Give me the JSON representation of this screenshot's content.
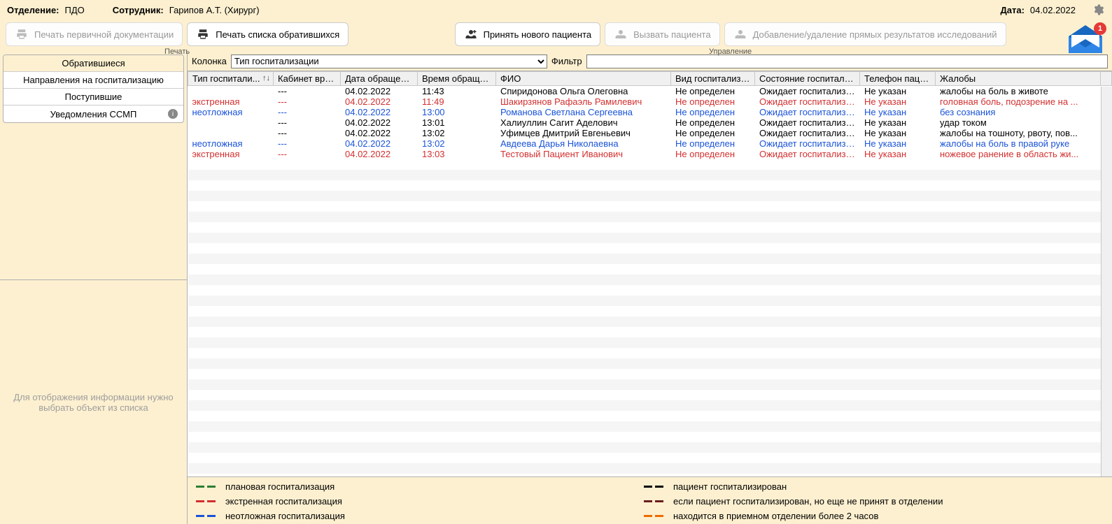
{
  "header": {
    "dept_label": "Отделение:",
    "dept_value": "ПДО",
    "employee_label": "Сотрудник:",
    "employee_value": "Гарипов А.Т. (Хирург)",
    "date_label": "Дата:",
    "date_value": "04.02.2022"
  },
  "toolbar": {
    "print_primary": "Печать первичной документации",
    "print_list": "Печать списка обратившихся",
    "group_print": "Печать",
    "accept_new": "Принять нового пациента",
    "call_patient": "Вызвать пациента",
    "add_remove_results": "Добавление/удаление прямых результатов исследований",
    "group_manage": "Управление",
    "mail_count": "1"
  },
  "nav": {
    "items": [
      {
        "label": "Обратившиеся",
        "active": true
      },
      {
        "label": "Направления на госпитализацию"
      },
      {
        "label": "Поступившие"
      },
      {
        "label": "Уведомления ССМП",
        "info": true
      }
    ]
  },
  "left_info": "Для отображения информации нужно выбрать объект из списка",
  "filter": {
    "column_label": "Колонка",
    "column_selected": "Тип госпитализации",
    "filter_label": "Фильтр",
    "filter_value": ""
  },
  "table": {
    "columns": [
      "Тип госпитали...",
      "Кабинет врача",
      "Дата обращения",
      "Время обращения",
      "ФИО",
      "Вид госпитализации",
      "Состояние госпитализации",
      "Телефон пациента",
      "Жалобы"
    ],
    "rows": [
      {
        "style": "black",
        "type": "",
        "cab": "---",
        "date": "04.02.2022",
        "time": "11:43",
        "fio": "Спиридонова Ольга Олеговна",
        "vid": "Не определен",
        "state": "Ожидает госпитализацию",
        "tel": "Не указан",
        "compl": "жалобы на боль в животе"
      },
      {
        "style": "red",
        "type": "экстренная",
        "cab": "---",
        "date": "04.02.2022",
        "time": "11:49",
        "fio": "Шакирзянов Рафаэль Рамилевич",
        "vid": "Не определен",
        "state": "Ожидает госпитализацию",
        "tel": "Не указан",
        "compl": "головная боль, подозрение на ..."
      },
      {
        "style": "blue",
        "type": "неотложная",
        "cab": "---",
        "date": "04.02.2022",
        "time": "13:00",
        "fio": "Романова Светлана Сергеевна",
        "vid": "Не определен",
        "state": "Ожидает госпитализацию",
        "tel": "Не указан",
        "compl": "без сознания"
      },
      {
        "style": "black",
        "type": "",
        "cab": "---",
        "date": "04.02.2022",
        "time": "13:01",
        "fio": "Халиуллин Сагит Аделович",
        "vid": "Не определен",
        "state": "Ожидает госпитализацию",
        "tel": "Не указан",
        "compl": "удар током"
      },
      {
        "style": "black",
        "type": "",
        "cab": "---",
        "date": "04.02.2022",
        "time": "13:02",
        "fio": "Уфимцев Дмитрий Евгеньевич",
        "vid": "Не определен",
        "state": "Ожидает госпитализацию",
        "tel": "Не указан",
        "compl": "жалобы на тошноту, рвоту, пов..."
      },
      {
        "style": "blue",
        "type": "неотложная",
        "cab": "---",
        "date": "04.02.2022",
        "time": "13:02",
        "fio": "Авдеева Дарья Николаевна",
        "vid": "Не определен",
        "state": "Ожидает госпитализацию",
        "tel": "Не указан",
        "compl": "жалобы на боль в правой руке"
      },
      {
        "style": "red",
        "type": "экстренная",
        "cab": "---",
        "date": "04.02.2022",
        "time": "13:03",
        "fio": "Тестовый Пациент Иванович",
        "vid": "Не определен",
        "state": "Ожидает госпитализацию",
        "tel": "Не указан",
        "compl": "ножевое ранение в область жи..."
      }
    ]
  },
  "legend": {
    "left": [
      {
        "color": "green",
        "label": "плановая госпитализация"
      },
      {
        "color": "red",
        "label": "экстренная госпитализация"
      },
      {
        "color": "blue",
        "label": "неотложная госпитализация"
      }
    ],
    "right": [
      {
        "color": "black",
        "label": "пациент госпитализирован"
      },
      {
        "color": "darkred",
        "label": "если пациент госпитализирован, но еще не принят в  отделении"
      },
      {
        "color": "orange",
        "label": "находится в приемном отделении более 2 часов"
      }
    ]
  }
}
